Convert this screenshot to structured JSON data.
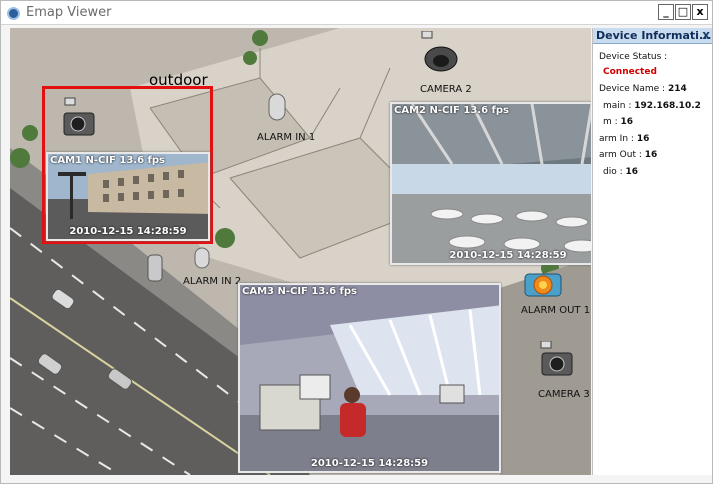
{
  "window": {
    "title": "Emap Viewer",
    "minimize": "_",
    "maximize": "□",
    "close": "x"
  },
  "map": {
    "outdoor_label": "outdoor",
    "devices": {
      "camera2": "CAMERA 2",
      "camera3": "CAMERA 3",
      "alarm_in_1": "ALARM IN 1",
      "alarm_in_2": "ALARM IN 2",
      "alarm_out_1": "ALARM OUT 1"
    },
    "videos": {
      "cam1": {
        "title": "CAM1 N-CIF 13.6 fps",
        "time": "2010-12-15  14:28:59"
      },
      "cam2": {
        "title": "CAM2 N-CIF 13.6 fps",
        "time": "2010-12-15  14:28:59"
      },
      "cam3": {
        "title": "CAM3 N-CIF 13.6 fps",
        "time": "2010-12-15  14:28:59"
      }
    }
  },
  "panel": {
    "title": "Device Informati...",
    "close": "x",
    "status_label": "Device Status :",
    "status_value": "Connected",
    "status_color": "#d40000",
    "name_label": "Device Name :",
    "name_value": "214",
    "domain_label": "main :",
    "domain_value": "192.168.10.2",
    "cam_label": "m :",
    "cam_value": "16",
    "alarm_in_label": "arm In :",
    "alarm_in_value": "16",
    "alarm_out_label": "arm Out :",
    "alarm_out_value": "16",
    "audio_label": "dio :",
    "audio_value": "16"
  }
}
